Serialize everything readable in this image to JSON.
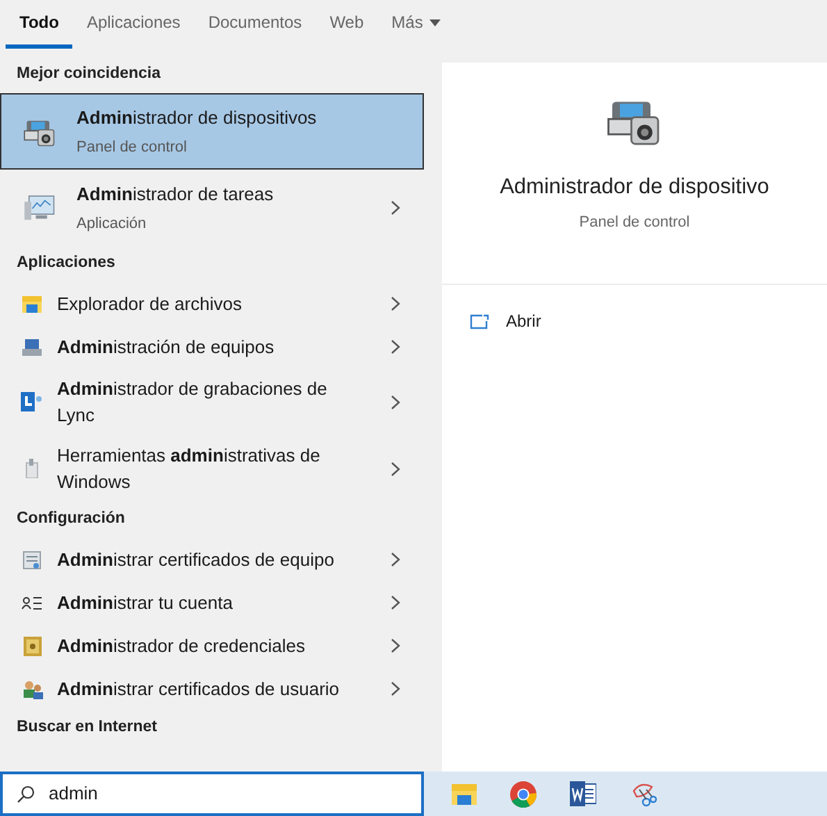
{
  "tabs": [
    {
      "label": "Todo",
      "selected": true
    },
    {
      "label": "Aplicaciones",
      "selected": false
    },
    {
      "label": "Documentos",
      "selected": false
    },
    {
      "label": "Web",
      "selected": false
    }
  ],
  "more_tab": {
    "label": "Más"
  },
  "sections": [
    {
      "title": "Mejor coincidencia",
      "items": [
        {
          "kind": "large",
          "title": "**Admin**istrador de dispositivos",
          "subtitle": "Panel de control",
          "selected": true,
          "chevron": false
        },
        {
          "kind": "large",
          "title": "**Admin**istrador de tareas",
          "subtitle": "Aplicación",
          "selected": false,
          "chevron": true
        }
      ]
    },
    {
      "title": "Aplicaciones",
      "items": [
        {
          "kind": "small",
          "title": "Explorador de archivos",
          "selected": false,
          "chevron": true
        },
        {
          "kind": "small",
          "title": "**Admin**istración de equipos",
          "selected": false,
          "chevron": true
        },
        {
          "kind": "small",
          "title": "**Admin**istrador de grabaciones de Lync",
          "selected": false,
          "chevron": true
        },
        {
          "kind": "small",
          "title": "Herramientas **admin**istrativas de Windows",
          "selected": false,
          "chevron": true
        }
      ]
    },
    {
      "title": "Configuración",
      "items": [
        {
          "kind": "small",
          "title": "**Admin**istrar certificados de equipo",
          "selected": false,
          "chevron": true
        },
        {
          "kind": "small",
          "title": "**Admin**istrar tu cuenta",
          "selected": false,
          "chevron": true
        },
        {
          "kind": "small",
          "title": "**Admin**istrador de credenciales",
          "selected": false,
          "chevron": true
        },
        {
          "kind": "small",
          "title": "**Admin**istrar certificados de usuario",
          "selected": false,
          "chevron": true
        }
      ]
    },
    {
      "title": "Buscar en Internet"
    }
  ],
  "preview": {
    "title": "Administrador de dispositivo",
    "subtitle": "Panel de control",
    "actions": [
      "Abrir"
    ]
  },
  "search": {
    "value": "admin"
  }
}
